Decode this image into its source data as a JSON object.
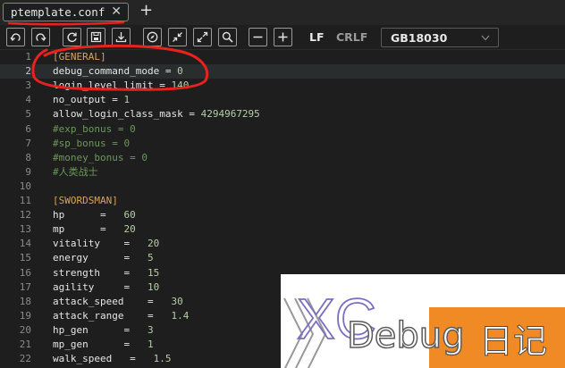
{
  "tab": {
    "title": "ptemplate.conf"
  },
  "toolbar": {
    "buttons": [
      "undo-icon",
      "redo-icon",
      "reload-icon",
      "save-icon",
      "download-icon",
      "compass-icon",
      "collapse-icon",
      "expand-icon",
      "search-icon",
      "zoom-out-icon",
      "zoom-in-icon"
    ],
    "lf": "LF",
    "crlf": "CRLF",
    "encoding": "GB18030"
  },
  "editor": {
    "active_line": 2,
    "lines": [
      {
        "n": "1",
        "sec": "[GENERAL]"
      },
      {
        "n": "2",
        "key": "debug_command_mode",
        "op": " = ",
        "val": "0"
      },
      {
        "n": "3",
        "key": "login_level_limit",
        "op": " = ",
        "val": "140"
      },
      {
        "n": "4",
        "key": "no_output",
        "op": " = ",
        "val": "1"
      },
      {
        "n": "5",
        "key": "allow_login_class_mask",
        "op": " = ",
        "val": "4294967295"
      },
      {
        "n": "6",
        "com": "#exp_bonus = 0"
      },
      {
        "n": "7",
        "com": "#sp_bonus = 0"
      },
      {
        "n": "8",
        "com": "#money_bonus = 0"
      },
      {
        "n": "9",
        "com": "#人类战士"
      },
      {
        "n": "10"
      },
      {
        "n": "11",
        "sec": "[SWORDSMAN]"
      },
      {
        "n": "12",
        "key": "hp",
        "op": "      =   ",
        "val": "60"
      },
      {
        "n": "13",
        "key": "mp",
        "op": "      =   ",
        "val": "20"
      },
      {
        "n": "14",
        "key": "vitality",
        "op": "    =   ",
        "val": "20"
      },
      {
        "n": "15",
        "key": "energy",
        "op": "      =   ",
        "val": "5"
      },
      {
        "n": "16",
        "key": "strength",
        "op": "    =   ",
        "val": "15"
      },
      {
        "n": "17",
        "key": "agility",
        "op": "     =   ",
        "val": "10"
      },
      {
        "n": "18",
        "key": "attack_speed",
        "op": "    =   ",
        "val": "30"
      },
      {
        "n": "19",
        "key": "attack_range",
        "op": "    =   ",
        "val": "1.4"
      },
      {
        "n": "20",
        "key": "hp_gen",
        "op": "      =   ",
        "val": "3"
      },
      {
        "n": "21",
        "key": "mp_gen",
        "op": "      =   ",
        "val": "1"
      },
      {
        "n": "22",
        "key": "walk_speed",
        "op": "   =   ",
        "val": "1.5"
      }
    ]
  },
  "watermark": {
    "logo": "XC",
    "text": "Debug",
    "text_cn": "日记"
  },
  "colors": {
    "accent_tab": "#3fae5c",
    "annotation": "#e8231e",
    "watermark_orange": "#f08a24",
    "section": "#d7a35a",
    "comment": "#6a9955",
    "number": "#b5cea8"
  }
}
